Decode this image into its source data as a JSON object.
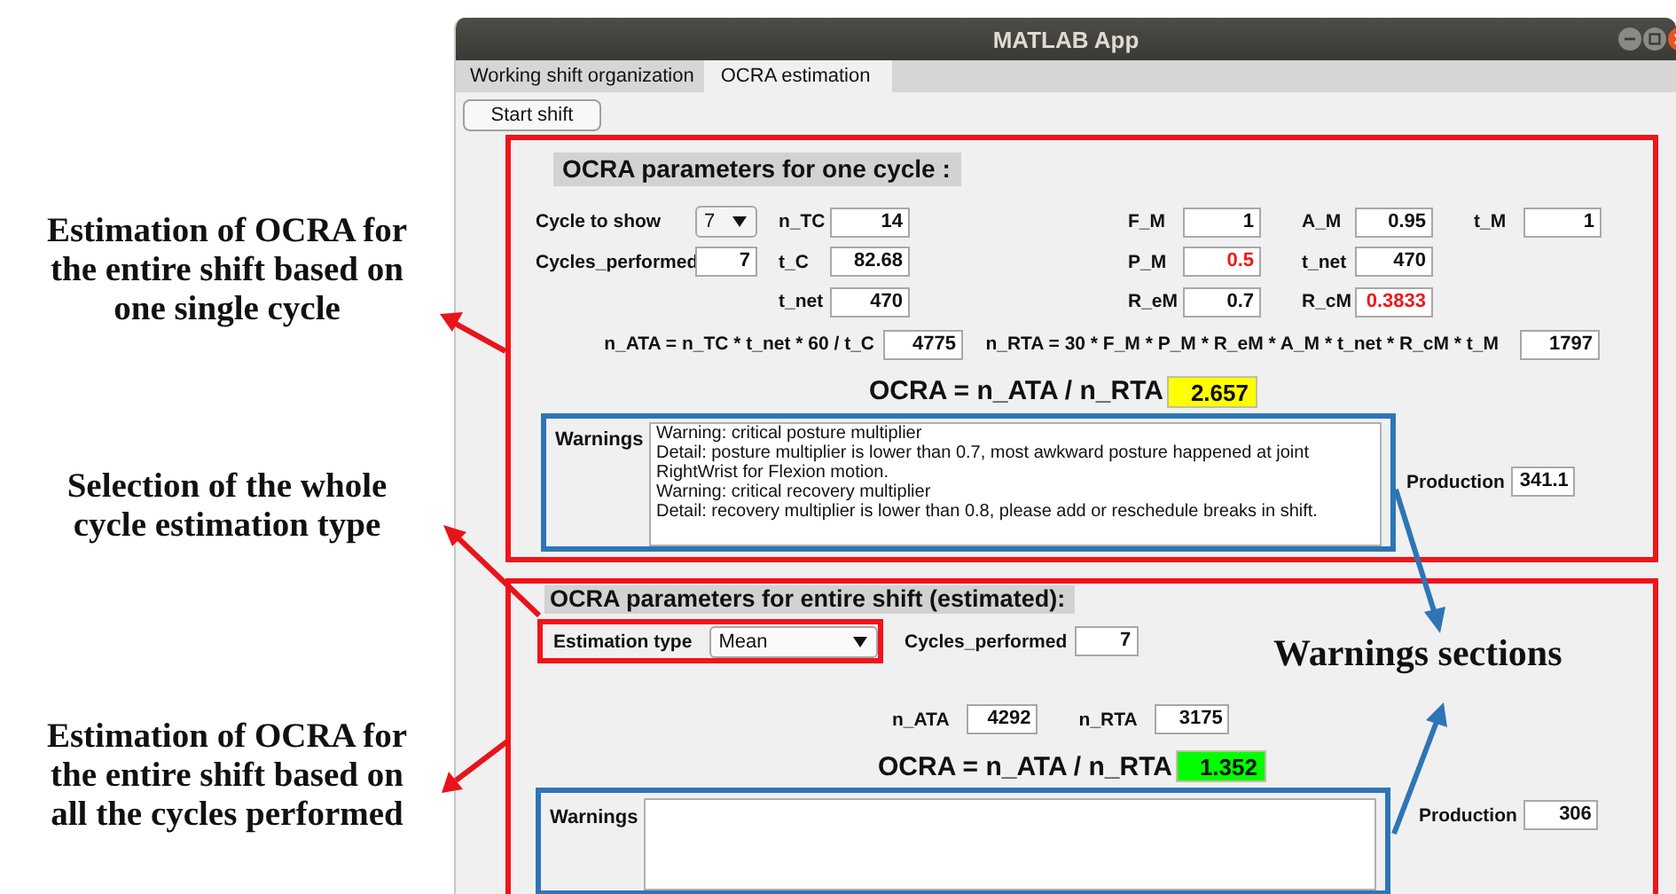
{
  "annotations": [
    {
      "lines": [
        "Estimation of OCRA for",
        "the entire shift based on",
        "one single cycle"
      ]
    },
    {
      "lines": [
        "Selection of the whole",
        "cycle estimation type"
      ]
    },
    {
      "lines": [
        "Estimation of OCRA for",
        "the entire shift based on",
        "all the cycles performed"
      ]
    }
  ],
  "callout": "Warnings sections",
  "window": {
    "title": "MATLAB App"
  },
  "tabs": [
    {
      "label": "Working shift organization",
      "selected": false
    },
    {
      "label": "OCRA estimation",
      "selected": true
    }
  ],
  "start_button": "Start shift",
  "one_cycle": {
    "title": "OCRA parameters for one cycle :",
    "cycle_to_show": {
      "label": "Cycle to show",
      "value": "7"
    },
    "cycles_performed": {
      "label": "Cycles_performed",
      "value": "7"
    },
    "left_fields": [
      {
        "label": "n_TC",
        "value": "14",
        "alert": false
      },
      {
        "label": "t_C",
        "value": "82.68",
        "alert": false
      },
      {
        "label": "t_net",
        "value": "470",
        "alert": false
      }
    ],
    "right_rows": [
      [
        {
          "label": "F_M",
          "value": "1",
          "alert": false
        },
        {
          "label": "A_M",
          "value": "0.95",
          "alert": false
        },
        {
          "label": "t_M",
          "value": "1",
          "alert": false
        }
      ],
      [
        {
          "label": "P_M",
          "value": "0.5",
          "alert": true
        },
        {
          "label": "t_net",
          "value": "470",
          "alert": false
        }
      ],
      [
        {
          "label": "R_eM",
          "value": "0.7",
          "alert": false
        },
        {
          "label": "R_cM",
          "value": "0.3833",
          "alert": true
        }
      ]
    ],
    "n_ata": {
      "label": "n_ATA = n_TC * t_net * 60 / t_C",
      "value": "4775"
    },
    "n_rta": {
      "label": "n_RTA = 30 * F_M * P_M * R_eM * A_M * t_net * R_cM * t_M",
      "value": "1797"
    },
    "ocra": {
      "label": "OCRA = n_ATA / n_RTA",
      "value": "2.657",
      "acceptable": false
    },
    "warnings": {
      "label": "Warnings",
      "lines": [
        "Warning:  critical posture multiplier",
        "Detail:  posture multiplier is lower than 0.7, most awkward posture happened at joint RightWrist for Flexion motion.",
        "Warning:  critical recovery multiplier",
        "Detail:  recovery multiplier is lower than 0.8, please add or reschedule breaks in shift."
      ]
    },
    "production": {
      "label": "Production",
      "value": "341.1"
    }
  },
  "entire_shift": {
    "title": "OCRA parameters for entire shift (estimated):",
    "estimation_type": {
      "label": "Estimation type",
      "value": "Mean"
    },
    "cycles_performed": {
      "label": "Cycles_performed",
      "value": "7"
    },
    "n_ata": {
      "label": "n_ATA",
      "value": "4292"
    },
    "n_rta": {
      "label": "n_RTA",
      "value": "3175"
    },
    "ocra": {
      "label": "OCRA = n_ATA / n_RTA",
      "value": "1.352",
      "acceptable": true
    },
    "warnings": {
      "label": "Warnings"
    },
    "production": {
      "label": "Production",
      "value": "306"
    }
  }
}
